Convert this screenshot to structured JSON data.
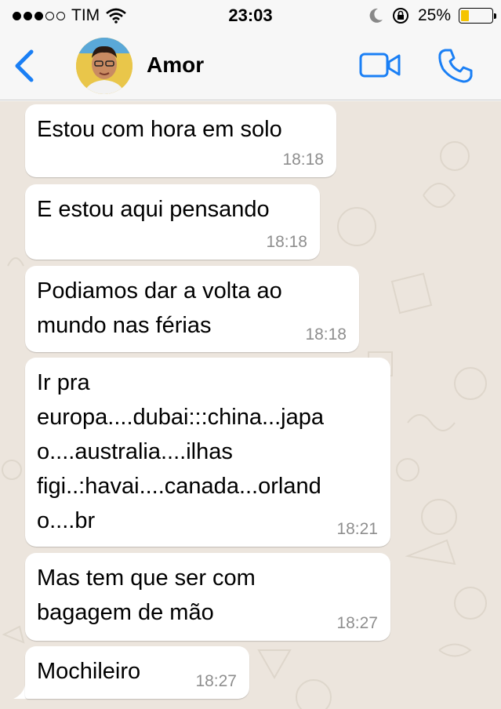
{
  "status_bar": {
    "carrier": "TIM",
    "time": "23:03",
    "battery_percent": "25%",
    "battery_level": 0.25,
    "battery_color": "#f5c400",
    "icons": [
      "signal-dots-icon",
      "wifi-icon",
      "moon-icon",
      "rotation-lock-icon",
      "battery-icon"
    ]
  },
  "nav_bar": {
    "contact_name": "Amor",
    "accent_color": "#1a7ff5",
    "icons": [
      "back-chevron-icon",
      "avatar",
      "video-call-icon",
      "phone-call-icon"
    ]
  },
  "messages": [
    {
      "text": "Estou com hora em solo",
      "time": "18:18"
    },
    {
      "text": "E estou aqui pensando",
      "time": "18:18"
    },
    {
      "text": "Podiamos dar a volta ao\nmundo nas férias",
      "time": "18:18"
    },
    {
      "text": "Ir pra\neuropa....dubai:::china...japa\no....australia....ilhas\nfigi..:havai....canada...orland\no....br",
      "time": "18:21"
    },
    {
      "text": "Mas tem que ser com\nbagagem de mão",
      "time": "18:27"
    },
    {
      "text": "Mochileiro",
      "time": "18:27"
    }
  ]
}
